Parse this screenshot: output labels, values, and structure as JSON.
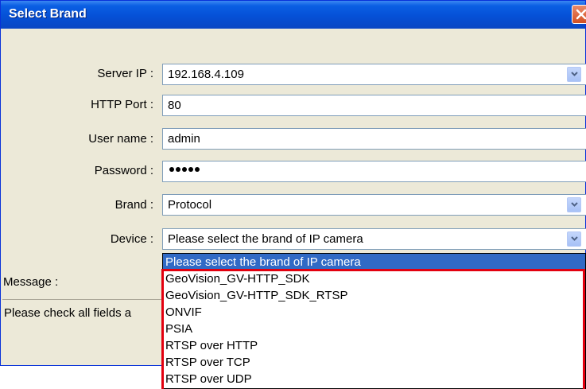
{
  "window": {
    "title": "Select Brand"
  },
  "form": {
    "server_ip": {
      "label": "Server IP :",
      "value": "192.168.4.109"
    },
    "http_port": {
      "label": "HTTP Port :",
      "value": "80"
    },
    "user_name": {
      "label": "User name :",
      "value": "admin"
    },
    "password": {
      "label": "Password :",
      "masked_length": 5
    },
    "brand": {
      "label": "Brand :",
      "value": "Protocol"
    },
    "device": {
      "label": "Device :",
      "value": "Please select the brand of IP camera"
    }
  },
  "message": {
    "label": "Message :",
    "text": "Please check all fields a"
  },
  "device_dropdown": {
    "options": [
      "Please select the brand of IP camera",
      "GeoVision_GV-HTTP_SDK",
      "GeoVision_GV-HTTP_SDK_RTSP",
      "ONVIF",
      "PSIA",
      "RTSP over HTTP",
      "RTSP over TCP",
      "RTSP over UDP"
    ],
    "selected_index": 0
  },
  "colors": {
    "titlebar": "#0a5fe3",
    "selection": "#316ac5",
    "highlight_border": "#e3000f",
    "dialog_bg": "#ece9d8"
  }
}
